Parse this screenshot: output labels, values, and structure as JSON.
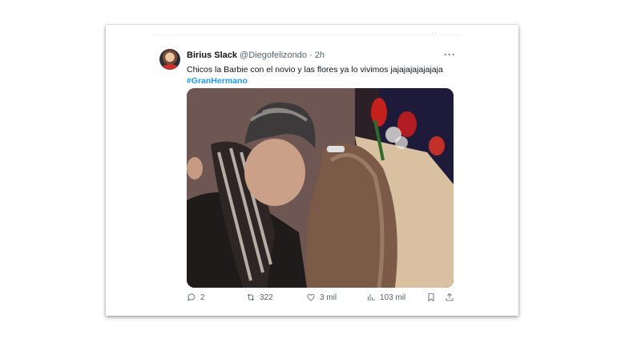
{
  "tweet": {
    "author_name": "Birius Slack",
    "author_handle": "@Diegofelizondo",
    "separator": "·",
    "time": "2h",
    "text": "Chicos la Barbie con el novio y las flores ya lo vivimos jajajajajajajaja",
    "hashtag": "#GranHermano",
    "image_alt": "photo of a man and a woman hugging, flower bouquet in the background"
  },
  "actions": {
    "replies": "2",
    "retweets": "322",
    "likes": "3 mil",
    "views": "103 mil"
  },
  "icons": {
    "reply": "reply-icon",
    "retweet": "retweet-icon",
    "like": "heart-icon",
    "views": "views-icon",
    "bookmark": "bookmark-icon",
    "share": "share-icon",
    "more": "more-icon"
  },
  "colors": {
    "link": "#1d9bf0",
    "text": "#0f1419",
    "secondary": "#536471"
  }
}
